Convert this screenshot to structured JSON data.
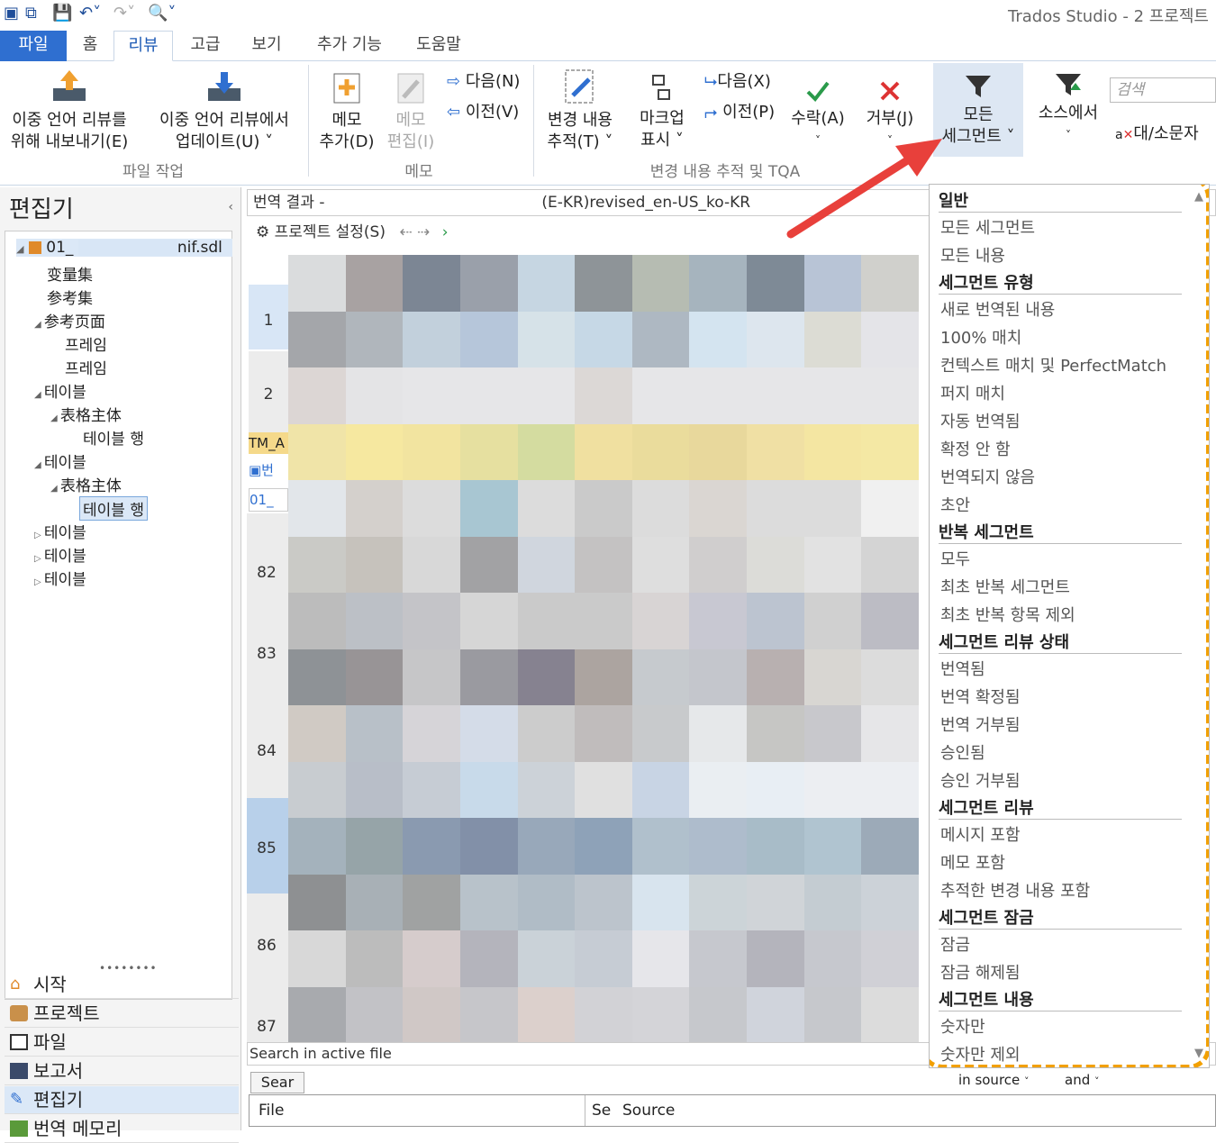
{
  "window": {
    "title": "Trados Studio - 2 프로젝트"
  },
  "tabs": [
    "파일",
    "홈",
    "리뷰",
    "고급",
    "보기",
    "추가 기능",
    "도움말"
  ],
  "ribbon": {
    "export_label_1": "이중 언어 리뷰를",
    "export_label_2": "위해 내보내기(E)",
    "update_label_1": "이중 언어 리뷰에서",
    "update_label_2": "업데이트(U) ˅",
    "group_file": "파일 작업",
    "memo_add_1": "메모",
    "memo_add_2": "추가(D)",
    "memo_edit_1": "메모",
    "memo_edit_2": "편집(I)",
    "memo_next": "다음(N)",
    "memo_prev": "이전(V)",
    "group_memo": "메모",
    "track_1": "변경 내용",
    "track_2": "추적(T) ˅",
    "markup_1": "마크업",
    "markup_2": "표시 ˅",
    "change_next": "다음(X)",
    "change_prev": "이전(P)",
    "accept": "수락(A)",
    "reject": "거부(J)",
    "group_tqa": "변경 내용 추적 및 TQA",
    "all_segments_1": "모든",
    "all_segments_2": "세그먼트 ˅",
    "from_source": "소스에서",
    "search_placeholder": "검색",
    "case": "대/소문자"
  },
  "left_panel": {
    "title": "편집기",
    "tree": [
      "01_",
      "nif.sdl",
      "变量集",
      "参考集",
      "参考页面",
      "프레임",
      "프레임",
      "테이블",
      "表格主体",
      "테이블 행",
      "테이블",
      "表格主体",
      "테이블 행",
      "테이블",
      "테이블",
      "테이블"
    ],
    "nav": [
      "시작",
      "프로젝트",
      "파일",
      "보고서",
      "편집기",
      "번역 메모리"
    ]
  },
  "center": {
    "header_prefix": "번역 결과 -",
    "header_file": "(E-KR)revised_en-US_ko-KR",
    "project_settings": "프로젝트 설정(S)",
    "row_numbers": [
      "1",
      "2",
      "82",
      "83",
      "84",
      "85",
      "86",
      "87"
    ],
    "tm_label": "TM_A",
    "search_placeholder": "Search in active file",
    "search_tab": "Sear",
    "in_source": "in source",
    "and": "and",
    "col_file": "File",
    "col_seg": "Se",
    "col_source": "Source"
  },
  "dropdown": {
    "sections": [
      {
        "heading": "일반",
        "items": [
          "모든 세그먼트",
          "모든 내용"
        ]
      },
      {
        "heading": "세그먼트 유형",
        "items": [
          "새로 번역된 내용",
          "100% 매치",
          "컨텍스트 매치 및 PerfectMatch",
          "퍼지 매치",
          "자동 번역됨",
          "확정 안 함",
          "번역되지 않음",
          "초안"
        ]
      },
      {
        "heading": "반복 세그먼트",
        "items": [
          "모두",
          "최초 반복 세그먼트",
          "최초 반복 항목 제외"
        ]
      },
      {
        "heading": "세그먼트 리뷰 상태",
        "items": [
          "번역됨",
          "번역 확정됨",
          "번역 거부됨",
          "승인됨",
          "승인 거부됨"
        ]
      },
      {
        "heading": "세그먼트 리뷰",
        "items": [
          "메시지 포함",
          "메모 포함",
          "추적한 변경 내용 포함"
        ]
      },
      {
        "heading": "세그먼트 잠금",
        "items": [
          "잠금",
          "잠금 해제됨"
        ]
      },
      {
        "heading": "세그먼트 내용",
        "items": [
          "숫자만",
          "숫자만 제외"
        ]
      }
    ]
  },
  "colors": {
    "accent": "#2f6fd0",
    "highlight": "#f2a000",
    "arrow": "#e8403b"
  }
}
